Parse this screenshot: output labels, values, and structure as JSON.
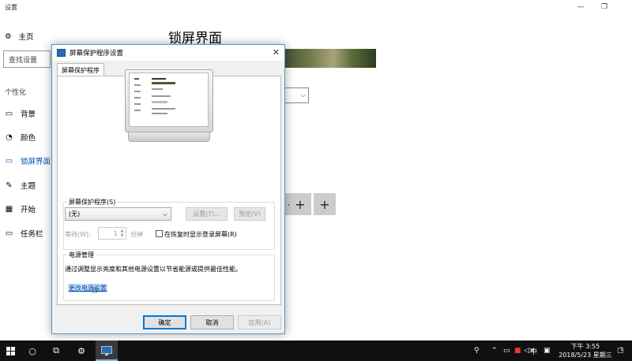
{
  "settings": {
    "window_title": "设置",
    "nav_home": "主页",
    "search_placeholder": "查找设置",
    "section_label": "个性化",
    "nav_items": [
      {
        "label": "背景",
        "icon": "image-icon"
      },
      {
        "label": "颜色",
        "icon": "palette-icon"
      },
      {
        "label": "锁屏界面",
        "icon": "lockscreen-icon",
        "active": true
      },
      {
        "label": "主题",
        "icon": "theme-icon"
      },
      {
        "label": "开始",
        "icon": "start-icon"
      },
      {
        "label": "任务栏",
        "icon": "taskbar-icon"
      }
    ],
    "page_title": "锁屏界面",
    "plus_label": "+",
    "accent_color": "#0050b3"
  },
  "dialog": {
    "title": "屏幕保护程序设置",
    "close_glyph": "✕",
    "tab": "屏幕保护程序",
    "screensaver_group": "屏幕保护程序(S)",
    "screensaver_value": "(无)",
    "settings_button": "设置(T)...",
    "preview_button": "预览(V)",
    "wait_label": "等待(W):",
    "wait_value": "1",
    "minutes_label": "分钟",
    "resume_checkbox": "在恢复时显示登录屏幕(R)",
    "power_group": "电源管理",
    "power_desc": "通过调整显示亮度和其他电源设置以节省能源或提供最佳性能。",
    "power_link": "更改电源设置",
    "ok_button": "确定",
    "cancel_button": "取消",
    "apply_button": "应用(A)"
  },
  "taskbar": {
    "time": "下午 3:55",
    "date": "2018/5/23 星期三",
    "ime": "中",
    "notifications": "1"
  }
}
